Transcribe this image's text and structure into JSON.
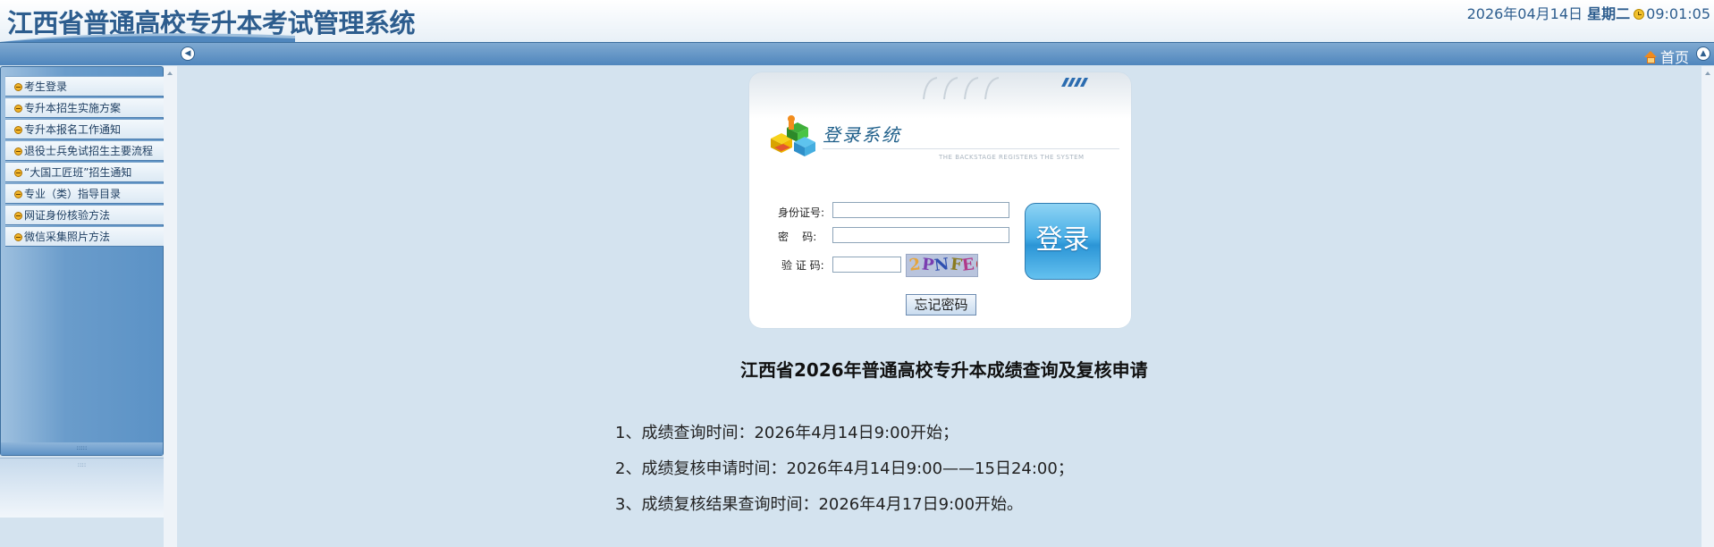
{
  "header": {
    "title": "江西省普通高校专升本考试管理系统",
    "date": "2026年04月14日",
    "weekday": "星期二",
    "time": "09:01:05"
  },
  "navbar": {
    "home_label": "首页"
  },
  "sidebar": {
    "items": [
      {
        "label": "考生登录"
      },
      {
        "label": "专升本招生实施方案"
      },
      {
        "label": "专升本报名工作通知"
      },
      {
        "label": "退役士兵免试招生主要流程"
      },
      {
        "label": "“大国工匠班”招生通知"
      },
      {
        "label": "专业（类）指导目录"
      },
      {
        "label": "网证身份核验方法"
      },
      {
        "label": "微信采集照片方法"
      }
    ]
  },
  "login": {
    "heading": "登录系统",
    "subtext": "THE BACKSTAGE REGISTERS THE SYSTEM",
    "id_label": "身份证号:",
    "id_value": "",
    "password_label": "密    码:",
    "password_value": "",
    "captcha_label": "验 证 码:",
    "captcha_value": "",
    "captcha_chars": [
      {
        "ch": "2",
        "color": "#e6a53c"
      },
      {
        "ch": "P",
        "color": "#7a3db0"
      },
      {
        "ch": "N",
        "color": "#2f4fb0"
      },
      {
        "ch": "F",
        "color": "#8a7a20"
      },
      {
        "ch": "E",
        "color": "#b03a8a"
      },
      {
        "ch": "C",
        "color": "#c43a3a"
      }
    ],
    "submit_label": "登录",
    "forgot_label": "忘记密码"
  },
  "notice": {
    "title": "江西省2026年普通高校专升本成绩查询及复核申请",
    "lines": [
      "1、成绩查询时间：2026年4月14日9:00开始；",
      "2、成绩复核申请时间：2026年4月14日9:00——15日24:00；",
      "3、成绩复核结果查询时间：2026年4月17日9:00开始。"
    ]
  },
  "colors": {
    "brand_blue": "#2d5d8e",
    "nav_blue": "#5b92c6",
    "content_bg": "#d4e3ef"
  }
}
